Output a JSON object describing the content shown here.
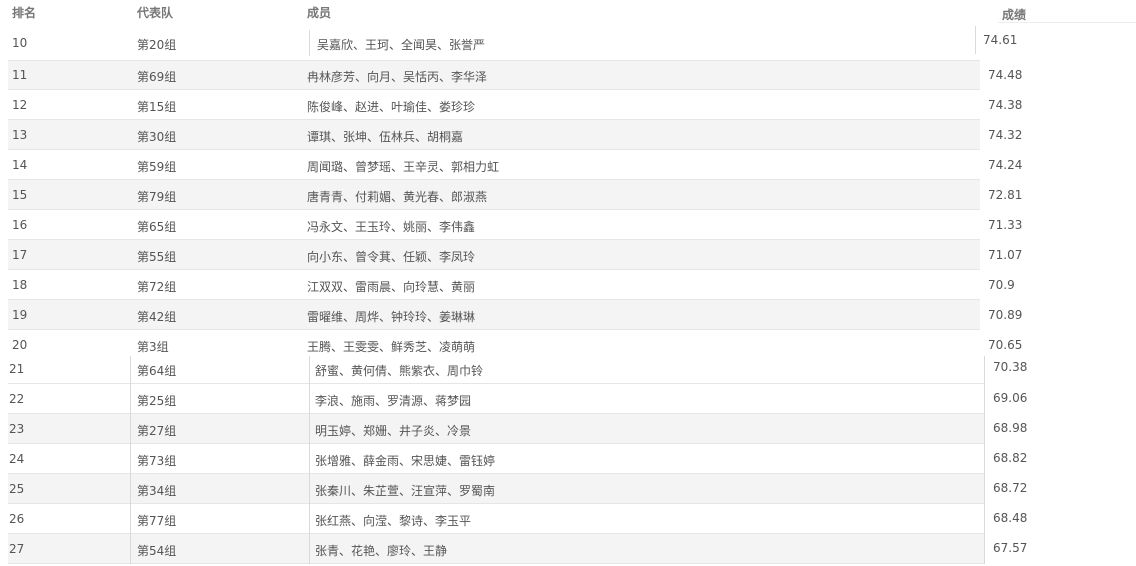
{
  "header": {
    "rank": "排名",
    "team": "代表队",
    "members": "成员",
    "score": "成绩"
  },
  "rows": [
    {
      "rank": "10",
      "team": "第20组",
      "members": "吴嘉欣、王珂、全闻昊、张誉严",
      "score": "74.61"
    },
    {
      "rank": "11",
      "team": "第69组",
      "members": "冉林彦芳、向月、吴恬丙、李华泽",
      "score": "74.48"
    },
    {
      "rank": "12",
      "team": "第15组",
      "members": "陈俊峰、赵进、叶瑜佳、娄珍珍",
      "score": "74.38"
    },
    {
      "rank": "13",
      "team": "第30组",
      "members": "谭琪、张坤、伍林兵、胡桐嘉",
      "score": "74.32"
    },
    {
      "rank": "14",
      "team": "第59组",
      "members": "周闻璐、曾梦瑶、王辛灵、郭相力虹",
      "score": "74.24"
    },
    {
      "rank": "15",
      "team": "第79组",
      "members": "唐青青、付莉媚、黄光春、郎淑燕",
      "score": "72.81"
    },
    {
      "rank": "16",
      "team": "第65组",
      "members": "冯永文、王玉玲、姚丽、李伟鑫",
      "score": "71.33"
    },
    {
      "rank": "17",
      "team": "第55组",
      "members": "向小东、曾令萁、任颖、李凤玲",
      "score": "71.07"
    },
    {
      "rank": "18",
      "team": "第72组",
      "members": "江双双、雷雨晨、向玲慧、黄丽",
      "score": "70.9"
    },
    {
      "rank": "19",
      "team": "第42组",
      "members": "雷曜维、周烨、钟玲玲、姜琳琳",
      "score": "70.89"
    },
    {
      "rank": "20",
      "team": "第3组",
      "members": "王腾、王雯雯、鲜秀芝、凌萌萌",
      "score": "70.65"
    },
    {
      "rank": "21",
      "team": "第64组",
      "members": "舒蜜、黄何倩、熊紫衣、周巾铃",
      "score": "70.38"
    },
    {
      "rank": "22",
      "team": "第25组",
      "members": "李浪、施雨、罗清源、蒋梦园",
      "score": "69.06"
    },
    {
      "rank": "23",
      "team": "第27组",
      "members": "明玉婷、郑姗、井子炎、冷景",
      "score": "68.98"
    },
    {
      "rank": "24",
      "team": "第73组",
      "members": "张增雅、薛金雨、宋思婕、雷钰婷",
      "score": "68.82"
    },
    {
      "rank": "25",
      "team": "第34组",
      "members": "张秦川、朱芷萱、汪宣萍、罗蜀南",
      "score": "68.72"
    },
    {
      "rank": "26",
      "team": "第77组",
      "members": "张红燕、向滢、黎诗、李玉平",
      "score": "68.48"
    },
    {
      "rank": "27",
      "team": "第54组",
      "members": "张青、花艳、廖玲、王静",
      "score": "67.57"
    }
  ]
}
